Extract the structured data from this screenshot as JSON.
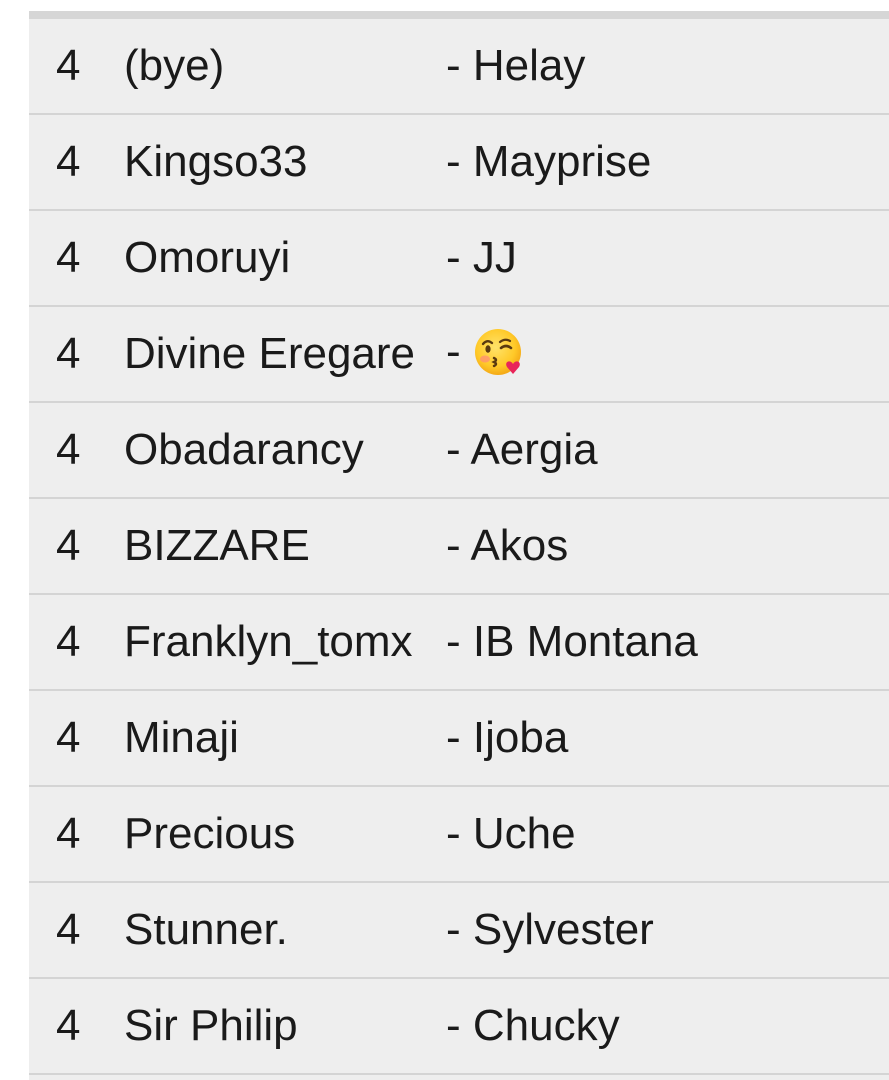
{
  "rows": [
    {
      "num": "4",
      "name": "(bye)",
      "partner": "- Helay"
    },
    {
      "num": "4",
      "name": "Kingso33",
      "partner": "- Mayprise"
    },
    {
      "num": "4",
      "name": "Omoruyi",
      "partner": "- JJ"
    },
    {
      "num": "4",
      "name": "Divine Eregare",
      "partner": "-",
      "partner_icon": "face-blowing-kiss-icon"
    },
    {
      "num": "4",
      "name": "Obadarancy",
      "partner": "- Aergia"
    },
    {
      "num": "4",
      "name": "BIZZARE",
      "partner": "- Akos"
    },
    {
      "num": "4",
      "name": "Franklyn_tomx",
      "partner": "- IB Montana"
    },
    {
      "num": "4",
      "name": "Minaji",
      "partner": "- Ijoba"
    },
    {
      "num": "4",
      "name": "Precious",
      "partner": "- Uche"
    },
    {
      "num": "4",
      "name": "Stunner.",
      "partner": "- Sylvester"
    },
    {
      "num": "4",
      "name": "Sir Philip",
      "partner": "- Chucky"
    }
  ]
}
